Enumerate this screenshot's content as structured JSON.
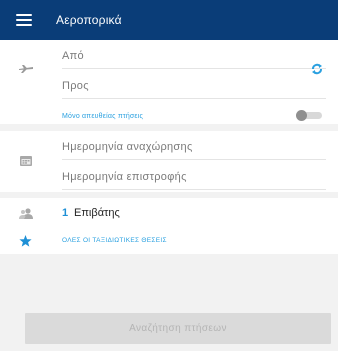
{
  "app_bar": {
    "title": "Αεροπορικά",
    "background": "#0a3d78"
  },
  "route": {
    "origin_placeholder": "Από",
    "destination_placeholder": "Προς",
    "swap_icon": "swap-arrows-icon",
    "direct_only_label": "Μόνο απευθείας πτήσεις",
    "direct_only_enabled": false
  },
  "dates": {
    "departure_placeholder": "Ημερομηνία αναχώρησης",
    "return_placeholder": "Ημερομηνία επιστροφής",
    "icon": "calendar-icon"
  },
  "passengers": {
    "count": "1",
    "label": "Επιβάτης",
    "icon": "person-icon"
  },
  "offers": {
    "label": "ΟΛΕΣ ΟΙ ΤΑΞΙΔΙΩΤΙΚΕΣ ΘΕΣΕΙΣ",
    "icon": "star-icon"
  },
  "search_button": {
    "label": "Αναζήτηση πτήσεων",
    "enabled": false
  },
  "colors": {
    "accent": "#2aa0e0",
    "primary": "#0a3d78"
  }
}
